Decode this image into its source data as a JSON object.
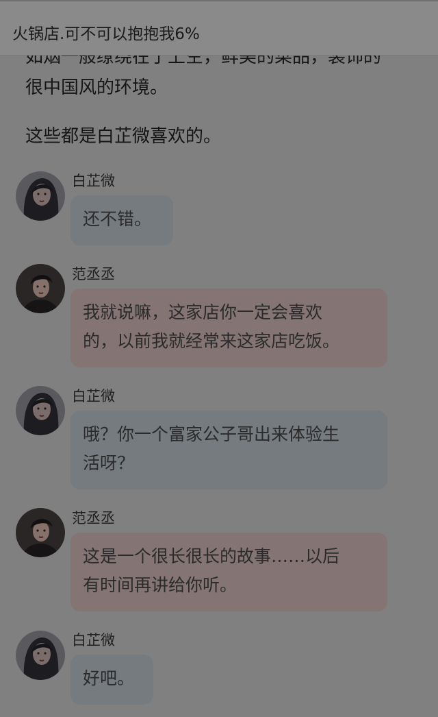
{
  "header": {
    "title": "火锅店.可不可以抱抱我6%"
  },
  "narration": [
    "如烟一般缭绕在了上空，鲜美的菜品，装饰的",
    "很中国风的环境。",
    "这些都是白芷微喜欢的。"
  ],
  "messages": [
    {
      "speaker": "白芷微",
      "avatar": "female-avatar",
      "lines": [
        "还不错。"
      ]
    },
    {
      "speaker": "范丞丞",
      "avatar": "male-avatar",
      "lines": [
        "我就说嘛，这家店你一定会喜欢",
        "的，以前我就经常来这家店吃饭。"
      ]
    },
    {
      "speaker": "白芷微",
      "avatar": "female-avatar",
      "lines": [
        "哦？你一个富家公子哥出来体验生",
        "活呀？"
      ]
    },
    {
      "speaker": "范丞丞",
      "avatar": "male-avatar",
      "lines": [
        "这是一个很长很长的故事……以后",
        "有时间再讲给你听。"
      ]
    },
    {
      "speaker": "白芷微",
      "avatar": "female-avatar",
      "lines": [
        "好吧。"
      ]
    }
  ],
  "colors": {
    "background": "#808080",
    "bubble_female": "#767b80",
    "bubble_male": "#857474"
  }
}
